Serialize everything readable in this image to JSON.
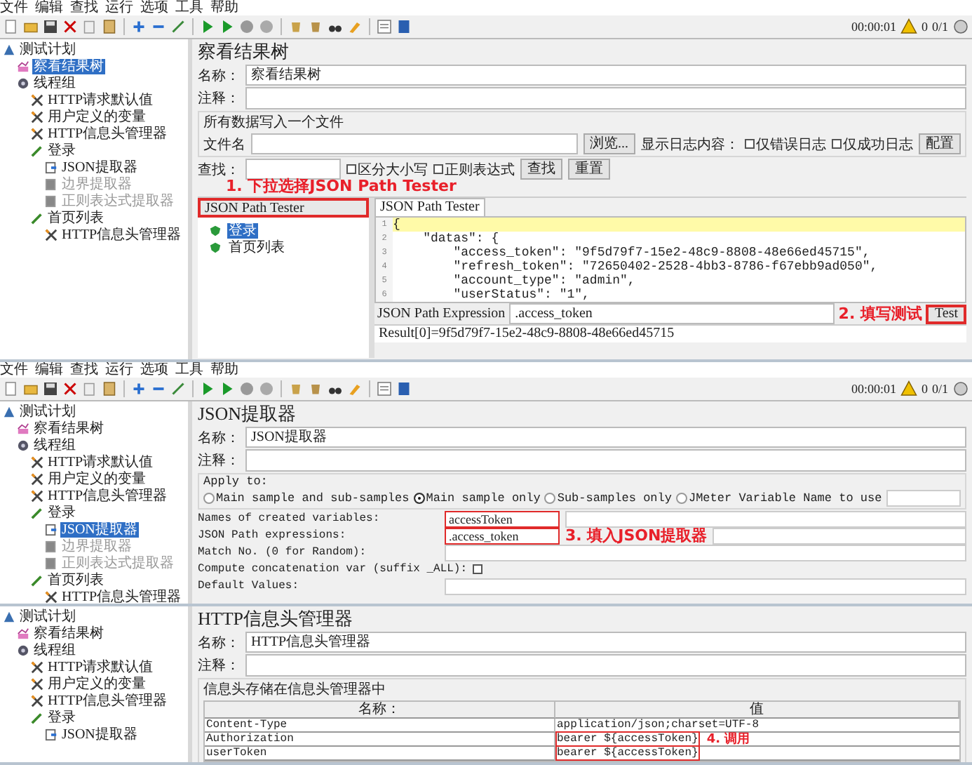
{
  "screens": [
    {
      "menu": [
        "文件",
        "编辑",
        "查找",
        "运行",
        "选项",
        "工具",
        "帮助"
      ],
      "status": {
        "time": "00:00:01",
        "warnings": "0",
        "threads": "0/1"
      },
      "tree": [
        {
          "label": "测试计划",
          "kind": "plan",
          "selected": false,
          "disabled": false,
          "children": [
            {
              "label": "察看结果树",
              "kind": "listener",
              "selected": true,
              "disabled": false
            },
            {
              "label": "线程组",
              "kind": "thread_group",
              "selected": false,
              "disabled": false,
              "children": [
                {
                  "label": "HTTP请求默认值",
                  "kind": "config",
                  "selected": false,
                  "disabled": false
                },
                {
                  "label": "用户定义的变量",
                  "kind": "config",
                  "selected": false,
                  "disabled": false
                },
                {
                  "label": "HTTP信息头管理器",
                  "kind": "config",
                  "selected": false,
                  "disabled": false
                },
                {
                  "label": "登录",
                  "kind": "sampler",
                  "selected": false,
                  "disabled": false,
                  "children": [
                    {
                      "label": "JSON提取器",
                      "kind": "extractor",
                      "selected": false,
                      "disabled": false
                    },
                    {
                      "label": "边界提取器",
                      "kind": "extractor",
                      "selected": false,
                      "disabled": true
                    },
                    {
                      "label": "正则表达式提取器",
                      "kind": "extractor",
                      "selected": false,
                      "disabled": true
                    }
                  ]
                },
                {
                  "label": "首页列表",
                  "kind": "sampler",
                  "selected": false,
                  "disabled": false,
                  "children": [
                    {
                      "label": "HTTP信息头管理器",
                      "kind": "config",
                      "selected": false,
                      "disabled": false
                    }
                  ]
                }
              ]
            }
          ]
        }
      ],
      "editor": {
        "kind": "results_tree",
        "title": "察看结果树",
        "name_label": "名称：",
        "name": "察看结果树",
        "comment_label": "注释：",
        "file_group": {
          "legend": "所有数据写入一个文件",
          "filename_label": "文件名",
          "browse": "浏览...",
          "log_label": "显示日志内容：",
          "options": [
            {
              "label": "仅错误日志",
              "checked": false
            },
            {
              "label": "仅成功日志",
              "checked": false
            }
          ],
          "configure": "配置"
        },
        "search": {
          "label": "查找：",
          "options": [
            {
              "label": "区分大小写",
              "checked": false
            },
            {
              "label": "正则表达式",
              "checked": false
            }
          ],
          "buttons": [
            "查找",
            "重置"
          ]
        },
        "renderer": {
          "value": "JSON Path Tester",
          "annotation": "1. 下拉选择JSON Path Tester"
        },
        "samples": [
          {
            "label": "登录",
            "selected": true
          },
          {
            "label": "首页列表",
            "selected": false
          }
        ],
        "tab": "JSON Path Tester",
        "code": [
          {
            "num": "1",
            "text": "{",
            "highlighted": true
          },
          {
            "num": "2",
            "text": "    \"datas\": {",
            "highlighted": false
          },
          {
            "num": "3",
            "text": "        \"access_token\": \"9f5d79f7-15e2-48c9-8808-48e66ed45715\",",
            "highlighted": false
          },
          {
            "num": "4",
            "text": "        \"refresh_token\": \"72650402-2528-4bb3-8786-f67ebb9ad050\",",
            "highlighted": false
          },
          {
            "num": "5",
            "text": "        \"account_type\": \"admin\",",
            "highlighted": false
          },
          {
            "num": "6",
            "text": "        \"userStatus\": \"1\",",
            "highlighted": false
          }
        ],
        "expression": {
          "label": "JSON Path Expression",
          "value": ".access_token",
          "annotation": "2. 填写测试",
          "button": "Test"
        },
        "result": "Result[0]=9f5d79f7-15e2-48c9-8808-48e66ed45715"
      }
    },
    {
      "menu": [
        "文件",
        "编辑",
        "查找",
        "运行",
        "选项",
        "工具",
        "帮助"
      ],
      "status": {
        "time": "00:00:01",
        "warnings": "0",
        "threads": "0/1"
      },
      "tree": [
        {
          "label": "测试计划",
          "kind": "plan",
          "selected": false,
          "disabled": false,
          "children": [
            {
              "label": "察看结果树",
              "kind": "listener",
              "selected": false,
              "disabled": false
            },
            {
              "label": "线程组",
              "kind": "thread_group",
              "selected": false,
              "disabled": false,
              "children": [
                {
                  "label": "HTTP请求默认值",
                  "kind": "config",
                  "selected": false,
                  "disabled": false
                },
                {
                  "label": "用户定义的变量",
                  "kind": "config",
                  "selected": false,
                  "disabled": false
                },
                {
                  "label": "HTTP信息头管理器",
                  "kind": "config",
                  "selected": false,
                  "disabled": false
                },
                {
                  "label": "登录",
                  "kind": "sampler",
                  "selected": false,
                  "disabled": false,
                  "children": [
                    {
                      "label": "JSON提取器",
                      "kind": "extractor",
                      "selected": true,
                      "disabled": false
                    },
                    {
                      "label": "边界提取器",
                      "kind": "extractor",
                      "selected": false,
                      "disabled": true
                    },
                    {
                      "label": "正则表达式提取器",
                      "kind": "extractor",
                      "selected": false,
                      "disabled": true
                    }
                  ]
                },
                {
                  "label": "首页列表",
                  "kind": "sampler",
                  "selected": false,
                  "disabled": false,
                  "children": [
                    {
                      "label": "HTTP信息头管理器",
                      "kind": "config",
                      "selected": false,
                      "disabled": false
                    }
                  ]
                }
              ]
            }
          ]
        }
      ],
      "editor": {
        "kind": "json_extractor",
        "title": "JSON提取器",
        "name_label": "名称：",
        "name": "JSON提取器",
        "comment_label": "注释：",
        "apply_label": "Apply to:",
        "scopes": [
          {
            "label": "Main sample and sub-samples",
            "selected": false
          },
          {
            "label": "Main sample only",
            "selected": true
          },
          {
            "label": "Sub-samples only",
            "selected": false
          },
          {
            "label": "JMeter Variable Name to use",
            "selected": false
          }
        ],
        "fields": [
          {
            "kind": "text",
            "label": "Names of created variables:",
            "value": "accessToken",
            "highlighted": true
          },
          {
            "kind": "text",
            "label": "JSON Path expressions:",
            "value": ".access_token",
            "highlighted": true
          },
          {
            "kind": "text",
            "label": "Match No. (0 for Random):",
            "highlighted": false
          },
          {
            "kind": "checkbox",
            "label": "Compute concatenation var (suffix _ALL):",
            "checked": false
          },
          {
            "kind": "text",
            "label": "Default Values:",
            "highlighted": false
          }
        ],
        "annotation": "3. 填入JSON提取器"
      }
    },
    {
      "tree": [
        {
          "label": "测试计划",
          "kind": "plan",
          "selected": false,
          "disabled": false,
          "children": [
            {
              "label": "察看结果树",
              "kind": "listener",
              "selected": false,
              "disabled": false
            },
            {
              "label": "线程组",
              "kind": "thread_group",
              "selected": false,
              "disabled": false,
              "children": [
                {
                  "label": "HTTP请求默认值",
                  "kind": "config",
                  "selected": false,
                  "disabled": false
                },
                {
                  "label": "用户定义的变量",
                  "kind": "config",
                  "selected": false,
                  "disabled": false
                },
                {
                  "label": "HTTP信息头管理器",
                  "kind": "config",
                  "selected": false,
                  "disabled": false
                },
                {
                  "label": "登录",
                  "kind": "sampler",
                  "selected": false,
                  "disabled": false,
                  "children": [
                    {
                      "label": "JSON提取器",
                      "kind": "extractor",
                      "selected": false,
                      "disabled": false
                    }
                  ]
                }
              ]
            }
          ]
        }
      ],
      "editor": {
        "kind": "header_manager",
        "title": "HTTP信息头管理器",
        "name_label": "名称：",
        "name": "HTTP信息头管理器",
        "comment_label": "注释：",
        "legend": "信息头存储在信息头管理器中",
        "columns": [
          "名称：",
          "值"
        ],
        "rows": [
          {
            "name": "Content-Type",
            "value": "application/json;charset=UTF-8",
            "highlighted": false
          },
          {
            "name": "Authorization",
            "value": "bearer ${accessToken}",
            "highlighted": true
          },
          {
            "name": "userToken",
            "value": "bearer ${accessToken}",
            "highlighted": true
          }
        ],
        "annotation": "4. 调用"
      }
    }
  ]
}
